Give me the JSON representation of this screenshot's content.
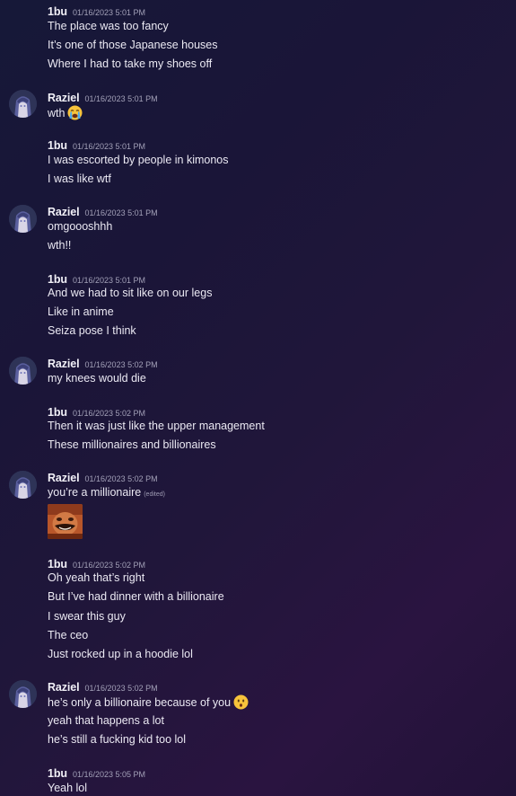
{
  "messages": {
    "g1": {
      "author": "1bu",
      "timestamp": "01/16/2023 5:01 PM",
      "lines": [
        "The place was too fancy",
        "It’s one of those Japanese houses",
        "Where I had to take my shoes off"
      ]
    },
    "g2": {
      "author": "Raziel",
      "timestamp": "01/16/2023 5:01 PM",
      "lines": [
        "wth"
      ],
      "emoji": "crying-face-icon"
    },
    "g3": {
      "author": "1bu",
      "timestamp": "01/16/2023 5:01 PM",
      "lines": [
        "I was escorted by people in kimonos",
        "I was like wtf"
      ]
    },
    "g4": {
      "author": "Raziel",
      "timestamp": "01/16/2023 5:01 PM",
      "lines": [
        "omgoooshhh",
        "wth!!"
      ]
    },
    "g5": {
      "author": "1bu",
      "timestamp": "01/16/2023 5:01 PM",
      "lines": [
        "And we had to sit like on our legs",
        "Like in anime",
        "Seiza pose I think"
      ]
    },
    "g6": {
      "author": "Raziel",
      "timestamp": "01/16/2023 5:02 PM",
      "lines": [
        "my knees would die"
      ]
    },
    "g7": {
      "author": "1bu",
      "timestamp": "01/16/2023 5:02 PM",
      "lines": [
        "Then it was just like the upper management",
        "These millionaires and billionaires"
      ]
    },
    "g8": {
      "author": "Raziel",
      "timestamp": "01/16/2023 5:02 PM",
      "lines": [
        "you’re a millionaire"
      ],
      "edited": "(edited)"
    },
    "g9": {
      "author": "1bu",
      "timestamp": "01/16/2023 5:02 PM",
      "lines": [
        "Oh yeah that’s right",
        "But I’ve had dinner with a billionaire",
        "I swear this guy",
        "The ceo",
        "Just rocked up in a hoodie lol"
      ]
    },
    "g10": {
      "author": "Raziel",
      "timestamp": "01/16/2023 5:02 PM",
      "lines": [
        "he’s only a billionaire because of you",
        "yeah that happens a lot",
        "he’s still a fucking kid too lol"
      ],
      "emoji": "kissing-face-icon"
    },
    "g11": {
      "author": "1bu",
      "timestamp": "01/16/2023 5:05 PM",
      "lines": [
        "Yeah lol"
      ]
    }
  },
  "colors": {
    "background_start": "#161838",
    "background_end": "#2a1440",
    "text": "#ebe9f3",
    "timestamp": "#a3a1b8"
  }
}
